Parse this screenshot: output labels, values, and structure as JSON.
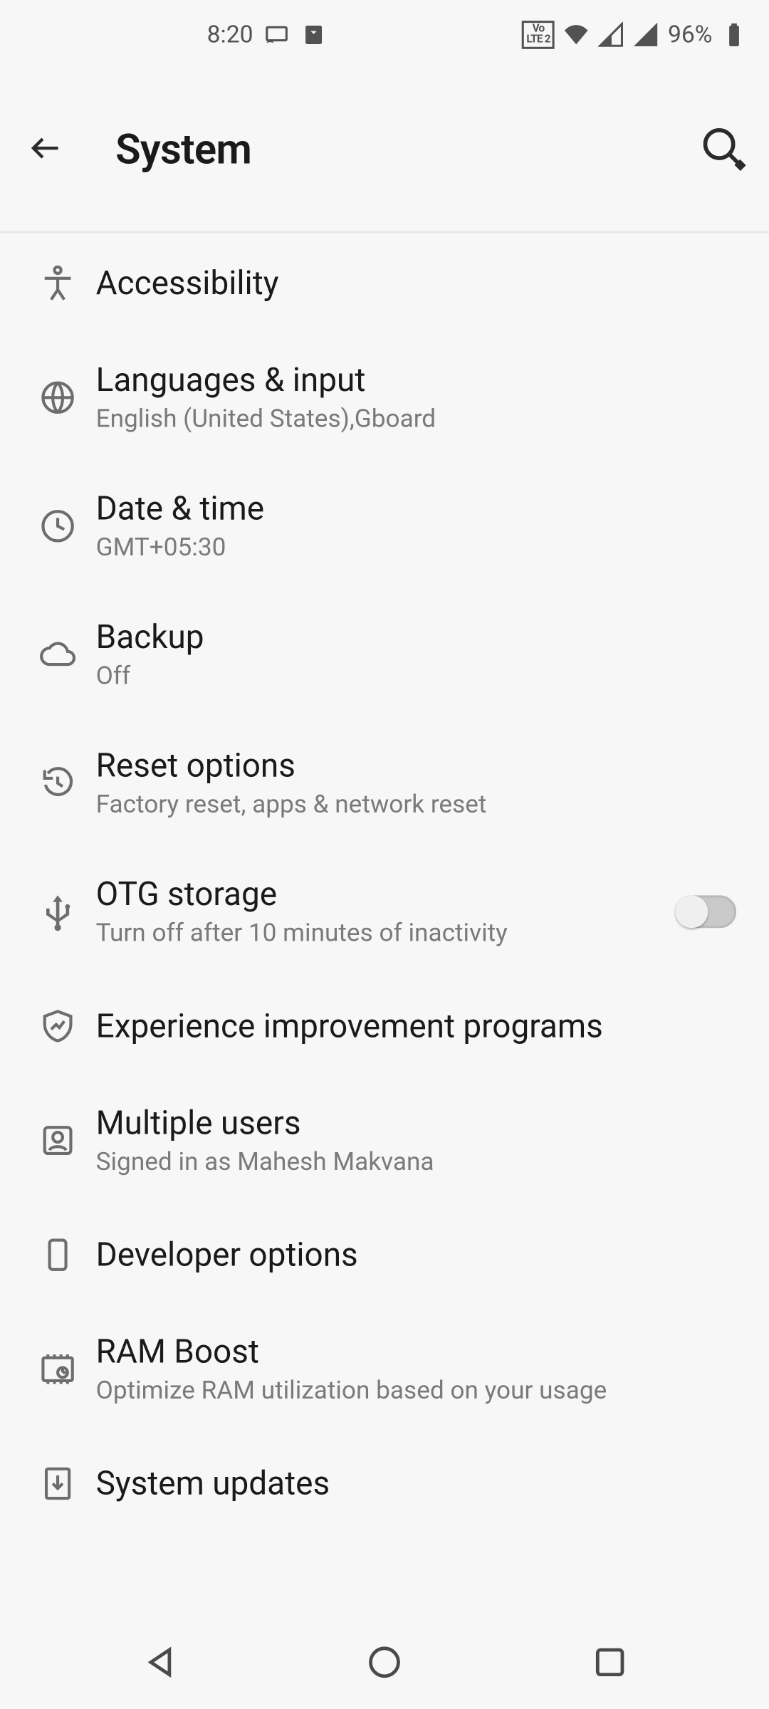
{
  "status": {
    "time": "8:20",
    "volte": "Vo\nLTE 2",
    "battery_pct": "96%"
  },
  "header": {
    "title": "System"
  },
  "items": [
    {
      "icon": "accessibility",
      "title": "Accessibility",
      "subtitle": "",
      "toggle": false
    },
    {
      "icon": "globe",
      "title": "Languages & input",
      "subtitle": "English (United States),Gboard",
      "toggle": false
    },
    {
      "icon": "clock",
      "title": "Date & time",
      "subtitle": "GMT+05:30",
      "toggle": false
    },
    {
      "icon": "cloud",
      "title": "Backup",
      "subtitle": "Off",
      "toggle": false
    },
    {
      "icon": "history",
      "title": "Reset options",
      "subtitle": "Factory reset, apps & network reset",
      "toggle": false
    },
    {
      "icon": "usb",
      "title": "OTG storage",
      "subtitle": "Turn off after 10 minutes of inactivity",
      "toggle": true
    },
    {
      "icon": "shield",
      "title": "Experience improvement programs",
      "subtitle": "",
      "toggle": false
    },
    {
      "icon": "user",
      "title": "Multiple users",
      "subtitle": "Signed in as Mahesh Makvana",
      "toggle": false
    },
    {
      "icon": "device",
      "title": "Developer options",
      "subtitle": "",
      "toggle": false
    },
    {
      "icon": "ram",
      "title": "RAM Boost",
      "subtitle": "Optimize RAM utilization based on your usage",
      "toggle": false
    },
    {
      "icon": "download",
      "title": "System updates",
      "subtitle": "",
      "toggle": false
    }
  ]
}
